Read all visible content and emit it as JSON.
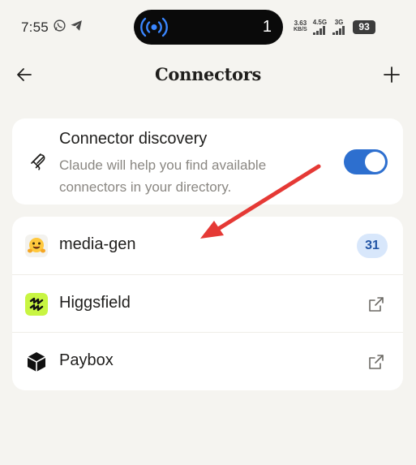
{
  "status_bar": {
    "time": "7:55",
    "island_count": "1",
    "net_speed_value": "3.63",
    "net_speed_unit": "KB/S",
    "signal1_label": "4.5G",
    "signal2_label": "3G",
    "battery": "93"
  },
  "header": {
    "title": "Connectors"
  },
  "discovery": {
    "title": "Connector discovery",
    "description": "Claude will help you find available connectors in your directory.",
    "toggle_on": true,
    "accent_color": "#2d6fcf"
  },
  "connectors": [
    {
      "name": "media-gen",
      "icon": "hugging-face-icon",
      "badge": "31"
    },
    {
      "name": "Higgsfield",
      "icon": "higgsfield-icon",
      "action_icon": "external-link-icon"
    },
    {
      "name": "Paybox",
      "icon": "paybox-icon",
      "action_icon": "external-link-icon"
    }
  ],
  "annotation": {
    "color": "#e53935"
  }
}
